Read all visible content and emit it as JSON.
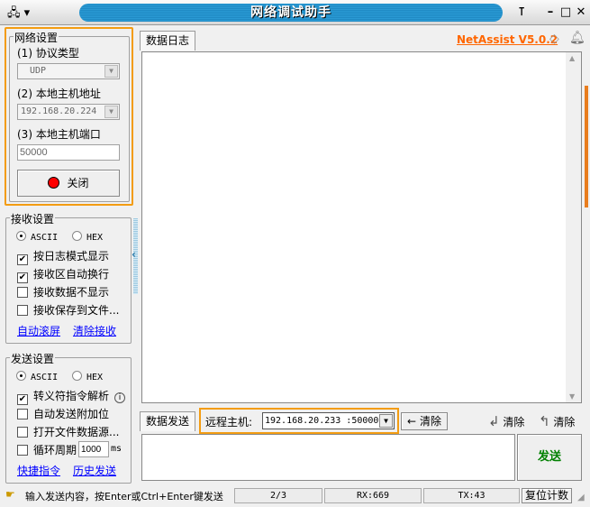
{
  "window": {
    "title": "网络调试助手",
    "brand": "NetAssist V5.0.2",
    "colors": {
      "accent": "#f39c12",
      "brand": "#ff6600",
      "send": "#008000",
      "link": "#0000ff"
    }
  },
  "network": {
    "title": "网络设置",
    "protocol_label": "(1) 协议类型",
    "protocol_value": "UDP",
    "host_label": "(2) 本地主机地址",
    "host_value": "192.168.20.224",
    "port_label": "(3) 本地主机端口",
    "port_value": "50000",
    "close_label": "关闭"
  },
  "receive": {
    "title": "接收设置",
    "ascii": "ASCII",
    "hex": "HEX",
    "encoding": "ASCII",
    "options": [
      {
        "label": "按日志模式显示",
        "checked": true
      },
      {
        "label": "接收区自动换行",
        "checked": true
      },
      {
        "label": "接收数据不显示",
        "checked": false
      },
      {
        "label": "接收保存到文件...",
        "checked": false
      }
    ],
    "link1": "自动滚屏",
    "link2": "清除接收"
  },
  "send": {
    "title": "发送设置",
    "ascii": "ASCII",
    "hex": "HEX",
    "encoding": "ASCII",
    "options": [
      {
        "label": "转义符指令解析",
        "checked": true
      },
      {
        "label": "自动发送附加位",
        "checked": false
      },
      {
        "label": "打开文件数据源...",
        "checked": false
      },
      {
        "label": "循环周期",
        "checked": false
      }
    ],
    "period": "1000",
    "period_unit": "ms",
    "link1": "快捷指令",
    "link2": "历史发送"
  },
  "log": {
    "tab": "数据日志"
  },
  "sendpane": {
    "tab": "数据发送",
    "remote_label": "远程主机:",
    "remote_value": "192.168.20.233 :50000",
    "clear1": "清除",
    "clear2": "清除",
    "clear3": "清除",
    "send_button": "发送"
  },
  "statusbar": {
    "hint": "输入发送内容，按Enter或Ctrl+Enter键发送",
    "count": "2/3",
    "rx": "RX:669",
    "tx": "TX:43",
    "reset": "复位计数"
  }
}
